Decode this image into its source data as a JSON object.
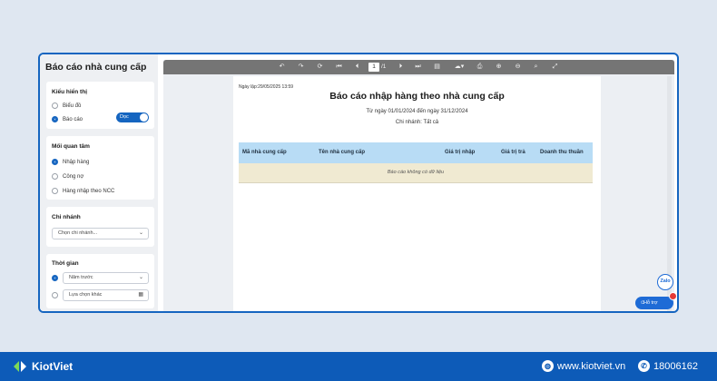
{
  "sidebar": {
    "title": "Báo cáo nhà cung cấp",
    "display": {
      "title": "Kiểu hiển thị",
      "options": [
        "Biểu đồ",
        "Báo cáo"
      ],
      "selected": "Báo cáo",
      "toggle_label": "Dọc"
    },
    "concern": {
      "title": "Mối quan tâm",
      "options": [
        "Nhập hàng",
        "Công nợ",
        "Hàng nhập theo NCC"
      ],
      "selected": "Nhập hàng"
    },
    "branch": {
      "title": "Chi nhánh",
      "placeholder": "Chọn chi nhánh..."
    },
    "time": {
      "title": "Thời gian",
      "preset_value": "Năm trước",
      "custom_value": "Lựa chọn khác"
    }
  },
  "toolbar": {
    "page_current": "1",
    "page_total": "/1"
  },
  "report": {
    "print_date": "Ngày lập:29/05/2025 13:59",
    "title": "Báo cáo nhập hàng theo nhà cung cấp",
    "date_range": "Từ ngày 01/01/2024 đến ngày 31/12/2024",
    "branch": "Chi nhánh: Tất cả",
    "columns": [
      "Mã nhà cung cấp",
      "Tên nhà cung cấp",
      "Giá trị nhập",
      "Giá trị trả",
      "Doanh thu thuần"
    ],
    "empty_message": "Báo cáo không có dữ liệu"
  },
  "widgets": {
    "zalo_label": "Zalo",
    "support_label": "Hỗ trợ"
  },
  "footer": {
    "brand": "KiotViet",
    "website": "www.kiotviet.vn",
    "hotline": "18006162"
  },
  "colors": {
    "accent": "#1565c0",
    "table_header": "#b8dcf5",
    "empty_row": "#f0ead2",
    "footer": "#0d5bb8",
    "alert": "#e53935"
  }
}
